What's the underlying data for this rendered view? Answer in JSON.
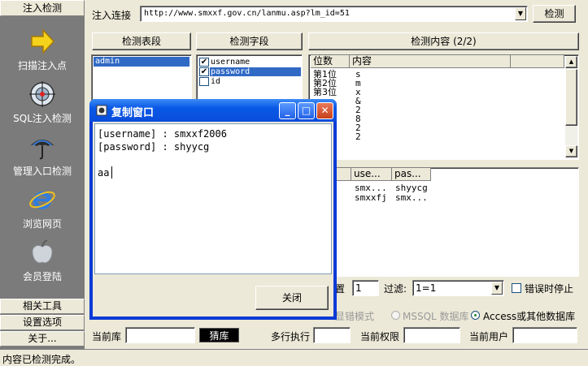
{
  "sidebar": {
    "header": "注入检测",
    "items": [
      {
        "label": "扫描注入点",
        "icon": "arrow-right-icon"
      },
      {
        "label": "SQL注入检测",
        "icon": "target-icon"
      },
      {
        "label": "管理入口检测",
        "icon": "umbrella-icon"
      },
      {
        "label": "浏览网页",
        "icon": "ie-icon"
      },
      {
        "label": "会员登陆",
        "icon": "apple-icon"
      }
    ],
    "footer": [
      "相关工具",
      "设置选项",
      "关于..."
    ]
  },
  "url_bar": {
    "label": "注入连接",
    "value": "http://www.smxxf.gov.cn/lanmu.asp?lm_id=51",
    "button": "检测"
  },
  "panels": {
    "tables_header": "检测表段",
    "fields_header": "检测字段",
    "content_header": "检测内容 (2/2)"
  },
  "tables": [
    "admin"
  ],
  "fields": [
    {
      "name": "username",
      "checked": true
    },
    {
      "name": "password",
      "checked": true
    },
    {
      "name": "id",
      "checked": false
    }
  ],
  "content_grid": {
    "columns": [
      "位数",
      "内容"
    ],
    "rows": [
      [
        "第1位",
        "s"
      ],
      [
        "第2位",
        "m"
      ],
      [
        "第3位",
        "x"
      ],
      [
        "",
        "&"
      ],
      [
        "",
        "2"
      ],
      [
        "",
        "8"
      ],
      [
        "",
        "2"
      ],
      [
        "",
        "2"
      ]
    ]
  },
  "results_grid": {
    "columns": [
      "use...",
      "pas..."
    ],
    "rows": [
      [
        "smx...",
        "shyycg"
      ],
      [
        "smxxfj",
        "smx..."
      ]
    ]
  },
  "options": {
    "position_label": "置",
    "position_value": "1",
    "filter_label": "过滤:",
    "filter_value": "1=1",
    "stop_on_error": "错误时停止",
    "error_mode": "显错模式",
    "mssql": "MSSQL 数据库",
    "access": "Access或其他数据库"
  },
  "bottom_bar": {
    "current_db": "当前库",
    "dark_btn": "猜库",
    "multi_exec": "多行执行",
    "current_perm": "当前权限",
    "current_user": "当前用户"
  },
  "status_bar": "内容已检测完成。",
  "dialog": {
    "title": "复制窗口",
    "lines": [
      "[username] : smxxf2006",
      "[password] : shyycg",
      "",
      "aa"
    ],
    "close_button": "关闭"
  },
  "colors": {
    "sidebar": "#7b7b7b",
    "selection": "#316ac5",
    "titlebar": "#0a4ddc",
    "close_btn": "#d9481c"
  }
}
